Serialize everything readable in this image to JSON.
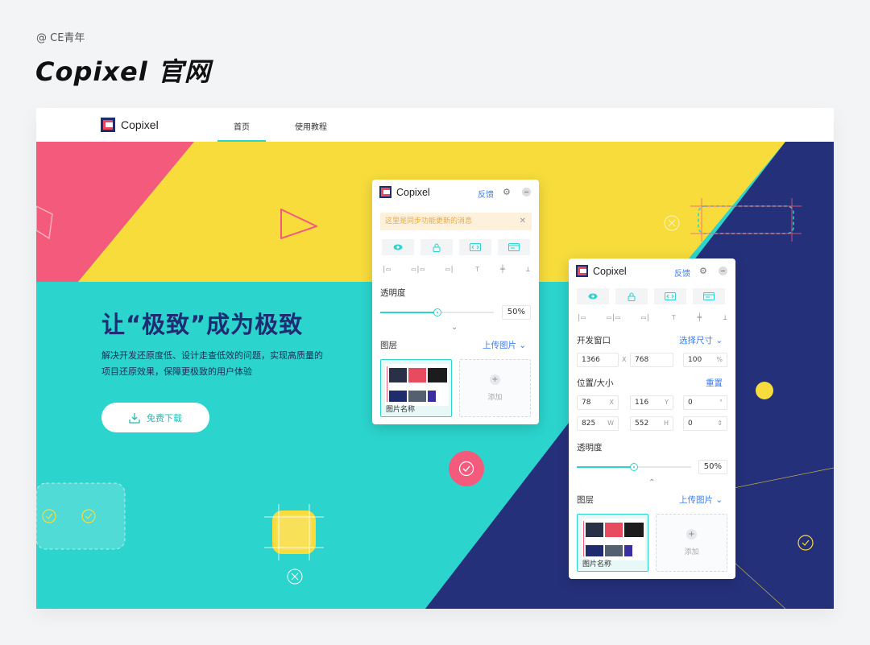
{
  "credit": "@ CE青年",
  "title": "Copixel 官网",
  "nav": {
    "brand": "Copixel",
    "links": [
      "首页",
      "使用教程"
    ]
  },
  "hero": {
    "headline": "让“极致”成为极致",
    "description_line1": "解决开发还原度低、设计走查低效的问题，实现高质量的",
    "description_line2": "项目还原效果，保障更极致的用户体验",
    "download_label": "免费下载"
  },
  "panel1": {
    "brand": "Copixel",
    "feedback": "反馈",
    "notice": "这里是同步功能更新的消息",
    "opacity_label": "透明度",
    "opacity_value": "50%",
    "opacity_level": 0.5,
    "layers_label": "图层",
    "upload_label": "上传图片",
    "layer_name": "图片名称",
    "add_label": "添加"
  },
  "panel2": {
    "brand": "Copixel",
    "feedback": "反馈",
    "window_label": "开发窗口",
    "choose_size": "选择尺寸",
    "width": "1366",
    "x_sep": "X",
    "height": "768",
    "zoom": "100",
    "zoom_unit": "%",
    "pos_label": "位置/大小",
    "reset": "重置",
    "pos_x": "78",
    "pos_x_unit": "X",
    "pos_y": "116",
    "pos_y_unit": "Y",
    "rotation": "0",
    "rotation_unit": "°",
    "size_w": "825",
    "size_w_unit": "W",
    "size_h": "552",
    "size_h_unit": "H",
    "extra": "0",
    "opacity_label": "透明度",
    "opacity_value": "50%",
    "opacity_level": 0.5,
    "layers_label": "图层",
    "upload_label": "上传图片",
    "layer_name": "图片名称",
    "add_label": "添加"
  },
  "colors": {
    "pink": "#f45a7c",
    "yellow": "#f7dc3c",
    "teal": "#2bd4cd",
    "navy": "#24307a",
    "accent_blue": "#3b7cf0"
  }
}
